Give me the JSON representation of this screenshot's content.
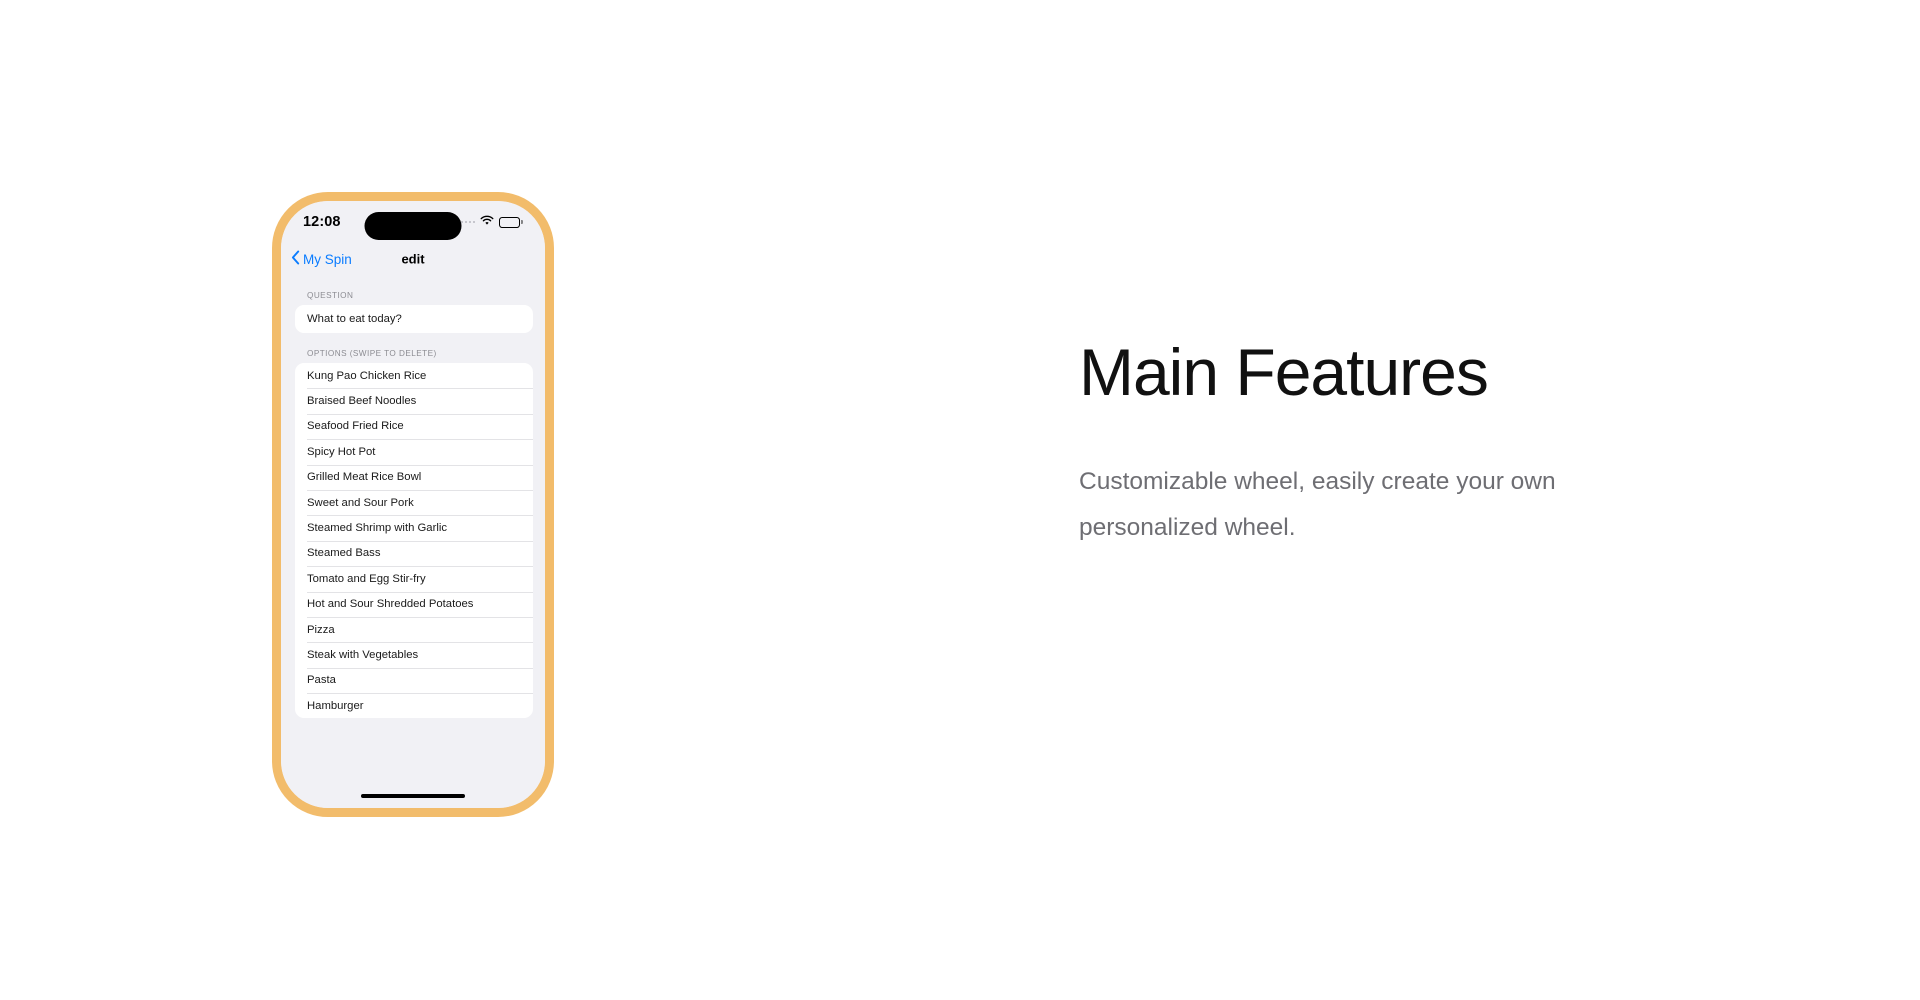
{
  "phone": {
    "status_bar": {
      "time": "12:08",
      "signal_icon": "signal-dots-icon",
      "wifi_icon": "wifi-icon",
      "battery_icon": "battery-icon",
      "dynamic_island": "dynamic-island"
    },
    "nav_bar": {
      "back_icon": "chevron-left-icon",
      "back_label": "My Spin",
      "title": "edit",
      "accent_color": "#0A7CFF"
    },
    "sections": [
      {
        "label": "QUESTION",
        "items": [
          "What to eat today?"
        ]
      },
      {
        "label": "OPTIONS (SWIPE TO DELETE)",
        "items": [
          "Kung Pao Chicken Rice",
          "Braised Beef Noodles",
          "Seafood Fried Rice",
          "Spicy Hot Pot",
          "Grilled Meat Rice Bowl",
          "Sweet and Sour Pork",
          "Steamed Shrimp with Garlic",
          "Steamed Bass",
          "Tomato and Egg Stir-fry",
          "Hot and Sour Shredded Potatoes",
          "Pizza",
          "Steak with Vegetables",
          "Pasta",
          "Hamburger"
        ]
      }
    ],
    "home_indicator": "home-indicator",
    "frame_color": "#F2BC6B",
    "screen_background": "#F1F1F5"
  },
  "copy": {
    "headline": "Main Features",
    "subhead": "Customizable wheel, easily create your own personalized wheel."
  }
}
